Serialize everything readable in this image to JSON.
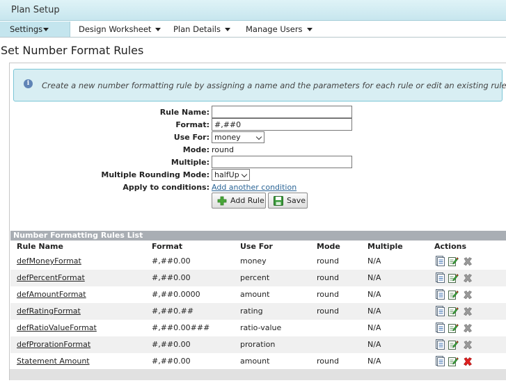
{
  "app": {
    "title": "Plan Setup"
  },
  "menu": [
    {
      "label": "Settings"
    },
    {
      "label": "Design Worksheet"
    },
    {
      "label": "Plan Details"
    },
    {
      "label": "Manage Users"
    }
  ],
  "page": {
    "title": "Set Number Format Rules"
  },
  "info": {
    "text": "Create a new number formatting rule by assigning a name and the parameters for each rule or edit an existing rule."
  },
  "form": {
    "rule_name_label": "Rule Name:",
    "rule_name_value": "",
    "format_label": "Format:",
    "format_value": "#,##0",
    "use_for_label": "Use For:",
    "use_for_value": "money",
    "mode_label": "Mode:",
    "mode_value": "round",
    "multiple_label": "Multiple:",
    "multiple_value": "",
    "rounding_label": "Multiple Rounding Mode:",
    "rounding_value": "halfUp",
    "conditions_label": "Apply to conditions:",
    "conditions_link": "Add another condition",
    "add_rule_button": "Add Rule",
    "save_button": "Save"
  },
  "table": {
    "title": "Number Formatting Rules List",
    "columns": [
      "Rule Name",
      "Format",
      "Use For",
      "Mode",
      "Multiple",
      "Actions"
    ],
    "rows": [
      {
        "name": "defMoneyFormat",
        "format": "#,##0.00",
        "use_for": "money",
        "mode": "round",
        "multiple": "N/A",
        "deletable": false
      },
      {
        "name": "defPercentFormat",
        "format": "#,##0.00",
        "use_for": "percent",
        "mode": "round",
        "multiple": "N/A",
        "deletable": false
      },
      {
        "name": "defAmountFormat",
        "format": "#,##0.0000",
        "use_for": "amount",
        "mode": "round",
        "multiple": "N/A",
        "deletable": false
      },
      {
        "name": "defRatingFormat",
        "format": "#,##0.##",
        "use_for": "rating",
        "mode": "round",
        "multiple": "N/A",
        "deletable": false
      },
      {
        "name": "defRatioValueFormat",
        "format": "#,##0.00###",
        "use_for": "ratio-value",
        "mode": "",
        "multiple": "N/A",
        "deletable": false
      },
      {
        "name": "defProrationFormat",
        "format": "#,##0.00",
        "use_for": "proration",
        "mode": "",
        "multiple": "N/A",
        "deletable": false
      },
      {
        "name": "Statement Amount",
        "format": "#,##0.00",
        "use_for": "amount",
        "mode": "round",
        "multiple": "N/A",
        "deletable": true
      }
    ]
  },
  "icons": {
    "info": "info-icon",
    "view": "document-view-icon",
    "edit": "edit-pencil-icon",
    "delete": "delete-x-icon",
    "add": "green-plus-icon",
    "save": "floppy-disk-icon"
  },
  "colors": {
    "header_bg": "#c7e6ee",
    "info_bg": "#d8eef3",
    "table_header": "#a9aeb4",
    "link": "#2a6496",
    "delete_active": "#e02020",
    "delete_disabled": "#9a9a9a"
  }
}
